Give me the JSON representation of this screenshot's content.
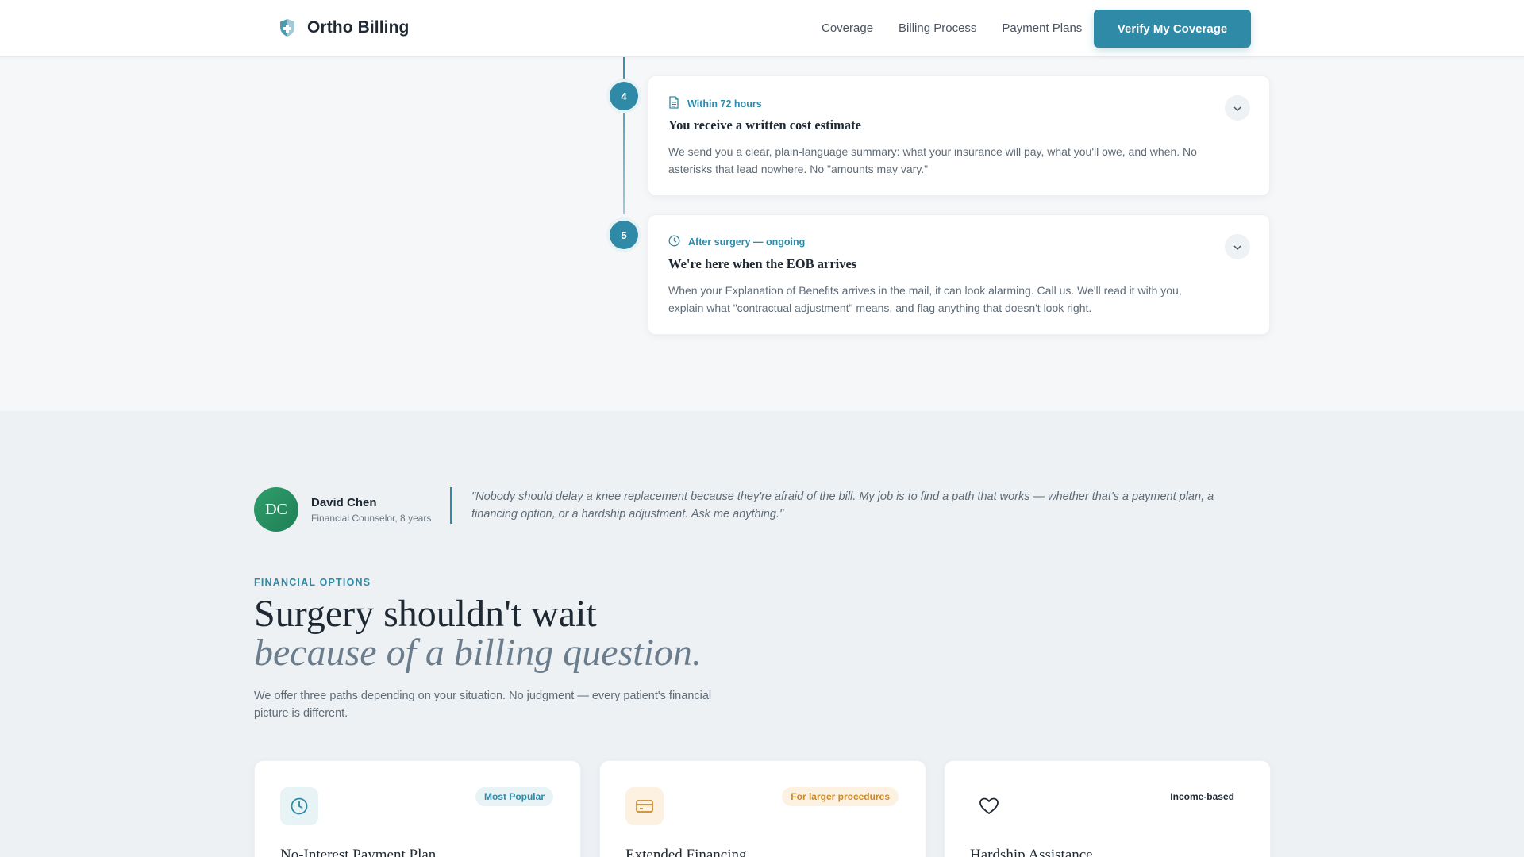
{
  "header": {
    "brand": "Ortho Billing",
    "nav": [
      "Coverage",
      "Billing Process",
      "Payment Plans"
    ],
    "cta": "Verify My Coverage"
  },
  "steps": [
    {
      "number": "4",
      "tag": "Within 72 hours",
      "icon": "document-icon",
      "title": "You receive a written cost estimate",
      "desc": "We send you a clear, plain-language summary: what your insurance will pay, what you'll owe, and when. No asterisks that lead nowhere. No \"amounts may vary.\""
    },
    {
      "number": "5",
      "tag": "After surgery — ongoing",
      "icon": "clock-icon",
      "title": "We're here when the EOB arrives",
      "desc": "When your Explanation of Benefits arrives in the mail, it can look alarming. Call us. We'll read it with you, explain what \"contractual adjustment\" means, and flag anything that doesn't look right."
    }
  ],
  "counselor": {
    "initials": "DC",
    "name": "David Chen",
    "role": "Financial Counselor, 8 years",
    "quote": "\"Nobody should delay a knee replacement because they're afraid of the bill. My job is to find a path that works — whether that's a payment plan, a financing option, or a hardship adjustment. Ask me anything.\""
  },
  "financial": {
    "kicker": "FINANCIAL OPTIONS",
    "heading": "Surgery shouldn't wait",
    "heading_italic": "because of a billing question.",
    "lead": "We offer three paths depending on your situation. No judgment — every patient's financial picture is different."
  },
  "options": [
    {
      "title": "No-Interest Payment Plan",
      "badge": "Most Popular",
      "icon": "clock-icon"
    },
    {
      "title": "Extended Financing",
      "badge": "For larger procedures",
      "icon": "credit-card-icon"
    },
    {
      "title": "Hardship Assistance",
      "badge": "Income-based",
      "icon": "heart-icon"
    }
  ],
  "colors": {
    "accent": "#2e8aa6",
    "avatar": "#2f9e6b",
    "amber": "#c98a2b"
  }
}
